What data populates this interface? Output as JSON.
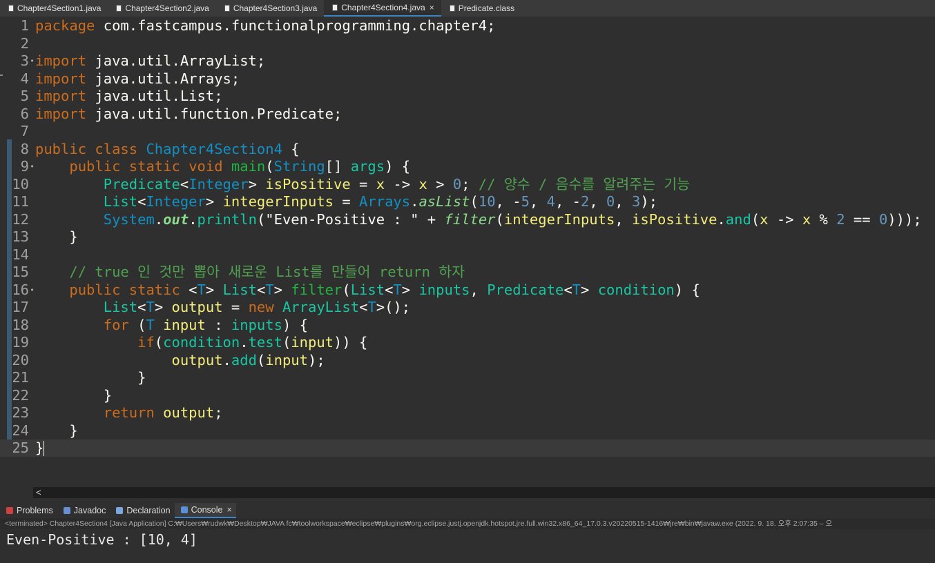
{
  "editor_tabs": [
    {
      "label": "Chapter4Section1.java",
      "active": false
    },
    {
      "label": "Chapter4Section2.java",
      "active": false
    },
    {
      "label": "Chapter4Section3.java",
      "active": false
    },
    {
      "label": "Chapter4Section4.java",
      "active": true,
      "close": "×"
    },
    {
      "label": "Predicate.class",
      "active": false
    }
  ],
  "code_lines": [
    {
      "num": "1",
      "tokens": [
        [
          "k",
          "package"
        ],
        [
          "d",
          " com.fastcampus.functionalprogramming.chapter4;"
        ]
      ]
    },
    {
      "num": "2",
      "tokens": []
    },
    {
      "num": "3",
      "fold": true,
      "tokens": [
        [
          "k",
          "import"
        ],
        [
          "d",
          " java.util.ArrayList;"
        ]
      ]
    },
    {
      "num": "4",
      "tokens": [
        [
          "k",
          "import"
        ],
        [
          "d",
          " java.util.Arrays;"
        ]
      ]
    },
    {
      "num": "5",
      "tokens": [
        [
          "k",
          "import"
        ],
        [
          "d",
          " java.util.List;"
        ]
      ]
    },
    {
      "num": "6",
      "tokens": [
        [
          "k",
          "import"
        ],
        [
          "d",
          " java.util.function.Predicate;"
        ]
      ]
    },
    {
      "num": "7",
      "tokens": []
    },
    {
      "num": "8",
      "tokens": [
        [
          "k",
          "public"
        ],
        [
          "d",
          " "
        ],
        [
          "k",
          "class"
        ],
        [
          "d",
          " "
        ],
        [
          "t",
          "Chapter4Section4"
        ],
        [
          "d",
          " {"
        ]
      ]
    },
    {
      "num": "9",
      "fold": true,
      "tokens": [
        [
          "d",
          "    "
        ],
        [
          "k",
          "public"
        ],
        [
          "d",
          " "
        ],
        [
          "k",
          "static"
        ],
        [
          "d",
          " "
        ],
        [
          "k",
          "void"
        ],
        [
          "d",
          " "
        ],
        [
          "m",
          "main"
        ],
        [
          "d",
          "("
        ],
        [
          "t",
          "String"
        ],
        [
          "d",
          "[] "
        ],
        [
          "s",
          "args"
        ],
        [
          "d",
          ") {"
        ]
      ]
    },
    {
      "num": "10",
      "tokens": [
        [
          "d",
          "        "
        ],
        [
          "s",
          "Predicate"
        ],
        [
          "d",
          "<"
        ],
        [
          "t",
          "Integer"
        ],
        [
          "d",
          "> "
        ],
        [
          "v",
          "isPositive"
        ],
        [
          "d",
          " = "
        ],
        [
          "v",
          "x"
        ],
        [
          "d",
          " -> "
        ],
        [
          "v",
          "x"
        ],
        [
          "d",
          " > "
        ],
        [
          "n",
          "0"
        ],
        [
          "d",
          "; "
        ],
        [
          "c",
          "// 양수 / 음수를 알려주는 기능"
        ]
      ]
    },
    {
      "num": "11",
      "tokens": [
        [
          "d",
          "        "
        ],
        [
          "s",
          "List"
        ],
        [
          "d",
          "<"
        ],
        [
          "t",
          "Integer"
        ],
        [
          "d",
          "> "
        ],
        [
          "v",
          "integerInputs"
        ],
        [
          "d",
          " = "
        ],
        [
          "t",
          "Arrays"
        ],
        [
          "d",
          "."
        ],
        [
          "f",
          "asList"
        ],
        [
          "d",
          "("
        ],
        [
          "n",
          "10"
        ],
        [
          "d",
          ", -"
        ],
        [
          "n",
          "5"
        ],
        [
          "d",
          ", "
        ],
        [
          "n",
          "4"
        ],
        [
          "d",
          ", -"
        ],
        [
          "n",
          "2"
        ],
        [
          "d",
          ", "
        ],
        [
          "n",
          "0"
        ],
        [
          "d",
          ", "
        ],
        [
          "n",
          "3"
        ],
        [
          "d",
          ");"
        ]
      ]
    },
    {
      "num": "12",
      "tokens": [
        [
          "d",
          "        "
        ],
        [
          "t",
          "System"
        ],
        [
          "d",
          "."
        ],
        [
          "o",
          "out"
        ],
        [
          "d",
          "."
        ],
        [
          "s",
          "println"
        ],
        [
          "d",
          "(\"Even-Positive : \" + "
        ],
        [
          "f",
          "filter"
        ],
        [
          "d",
          "("
        ],
        [
          "v",
          "integerInputs"
        ],
        [
          "d",
          ", "
        ],
        [
          "v",
          "isPositive"
        ],
        [
          "d",
          "."
        ],
        [
          "s",
          "and"
        ],
        [
          "d",
          "("
        ],
        [
          "v",
          "x"
        ],
        [
          "d",
          " -> "
        ],
        [
          "v",
          "x"
        ],
        [
          "d",
          " % "
        ],
        [
          "n",
          "2"
        ],
        [
          "d",
          " == "
        ],
        [
          "n",
          "0"
        ],
        [
          "d",
          ")));"
        ]
      ]
    },
    {
      "num": "13",
      "tokens": [
        [
          "d",
          "    }"
        ]
      ]
    },
    {
      "num": "14",
      "tokens": []
    },
    {
      "num": "15",
      "tokens": [
        [
          "d",
          "    "
        ],
        [
          "c",
          "// "
        ],
        [
          "c",
          "true"
        ],
        [
          "c",
          " 인 것만 뽑아 새로운 "
        ],
        [
          "c",
          "List"
        ],
        [
          "c",
          "를 만들어 "
        ],
        [
          "c",
          "return"
        ],
        [
          "c",
          " 하자"
        ]
      ]
    },
    {
      "num": "16",
      "fold": true,
      "tokens": [
        [
          "d",
          "    "
        ],
        [
          "k",
          "public"
        ],
        [
          "d",
          " "
        ],
        [
          "k",
          "static"
        ],
        [
          "d",
          " <"
        ],
        [
          "t",
          "T"
        ],
        [
          "d",
          "> "
        ],
        [
          "s",
          "List"
        ],
        [
          "d",
          "<"
        ],
        [
          "t",
          "T"
        ],
        [
          "d",
          "> "
        ],
        [
          "m",
          "filter"
        ],
        [
          "d",
          "("
        ],
        [
          "s",
          "List"
        ],
        [
          "d",
          "<"
        ],
        [
          "t",
          "T"
        ],
        [
          "d",
          "> "
        ],
        [
          "s",
          "inputs"
        ],
        [
          "d",
          ", "
        ],
        [
          "s",
          "Predicate"
        ],
        [
          "d",
          "<"
        ],
        [
          "t",
          "T"
        ],
        [
          "d",
          "> "
        ],
        [
          "s",
          "condition"
        ],
        [
          "d",
          ") {"
        ]
      ]
    },
    {
      "num": "17",
      "tokens": [
        [
          "d",
          "        "
        ],
        [
          "s",
          "List"
        ],
        [
          "d",
          "<"
        ],
        [
          "t",
          "T"
        ],
        [
          "d",
          "> "
        ],
        [
          "v",
          "output"
        ],
        [
          "d",
          " = "
        ],
        [
          "k",
          "new"
        ],
        [
          "d",
          " "
        ],
        [
          "s",
          "ArrayList"
        ],
        [
          "d",
          "<"
        ],
        [
          "t",
          "T"
        ],
        [
          "d",
          ">();"
        ]
      ]
    },
    {
      "num": "18",
      "tokens": [
        [
          "d",
          "        "
        ],
        [
          "k",
          "for"
        ],
        [
          "d",
          " ("
        ],
        [
          "t",
          "T"
        ],
        [
          "d",
          " "
        ],
        [
          "v",
          "input"
        ],
        [
          "d",
          " : "
        ],
        [
          "s",
          "inputs"
        ],
        [
          "d",
          ") {"
        ]
      ]
    },
    {
      "num": "19",
      "tokens": [
        [
          "d",
          "            "
        ],
        [
          "k",
          "if"
        ],
        [
          "d",
          "("
        ],
        [
          "s",
          "condition"
        ],
        [
          "d",
          "."
        ],
        [
          "s",
          "test"
        ],
        [
          "d",
          "("
        ],
        [
          "v",
          "input"
        ],
        [
          "d",
          ")) {"
        ]
      ]
    },
    {
      "num": "20",
      "tokens": [
        [
          "d",
          "                "
        ],
        [
          "v",
          "output"
        ],
        [
          "d",
          "."
        ],
        [
          "s",
          "add"
        ],
        [
          "d",
          "("
        ],
        [
          "v",
          "input"
        ],
        [
          "d",
          ");"
        ]
      ]
    },
    {
      "num": "21",
      "tokens": [
        [
          "d",
          "            }"
        ]
      ]
    },
    {
      "num": "22",
      "tokens": [
        [
          "d",
          "        }"
        ]
      ]
    },
    {
      "num": "23",
      "tokens": [
        [
          "d",
          "        "
        ],
        [
          "k",
          "return"
        ],
        [
          "d",
          " "
        ],
        [
          "v",
          "output"
        ],
        [
          "d",
          ";"
        ]
      ]
    },
    {
      "num": "24",
      "tokens": [
        [
          "d",
          "    }"
        ]
      ]
    },
    {
      "num": "25",
      "current": true,
      "tokens": [
        [
          "d",
          "}"
        ]
      ]
    }
  ],
  "scroll_arrow": "<",
  "view_tabs": [
    {
      "label": "Problems",
      "icon": "problems-icon",
      "color": "#d04040",
      "active": false
    },
    {
      "label": "Javadoc",
      "icon": "javadoc-icon",
      "color": "#6a8fd0",
      "active": false
    },
    {
      "label": "Declaration",
      "icon": "declaration-icon",
      "color": "#7aa7e0",
      "active": false
    },
    {
      "label": "Console",
      "icon": "console-icon",
      "color": "#5b8fd6",
      "active": true,
      "close": "×"
    }
  ],
  "console": {
    "status": "<terminated> Chapter4Section4 [Java Application] C:₩Users₩rudwk₩Desktop₩JAVA fc₩toolworkspace₩eclipse₩plugins₩org.eclipse.justj.openjdk.hotspot.jre.full.win32.x86_64_17.0.3.v20220515-1416₩jre₩bin₩javaw.exe  (2022. 9. 18. 오후 2:07:35 – 오",
    "output": "Even-Positive : [10, 4]"
  },
  "colors": {
    "background": "#2f2f2f",
    "keyword": "#cc6c1d",
    "comment": "#4fa14f",
    "number": "#6897bb",
    "active_tab_underline": "#3d85c6"
  }
}
